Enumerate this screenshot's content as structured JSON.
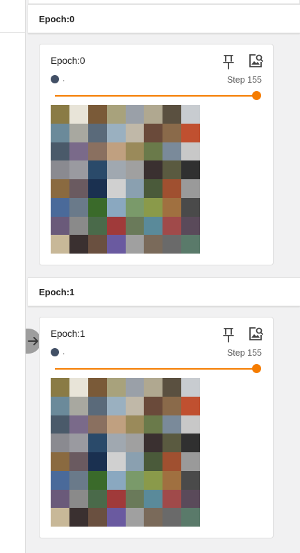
{
  "groups": [
    {
      "header_title": "Epoch:0",
      "card": {
        "title": "Epoch:0",
        "run_name": ".",
        "step_text": "Step 155",
        "slider_value_fraction": 1.0
      }
    },
    {
      "header_title": "Epoch:1",
      "card": {
        "title": "Epoch:1",
        "run_name": ".",
        "step_text": "Step 155",
        "slider_value_fraction": 1.0
      }
    }
  ],
  "icons": {
    "pin": "pin-icon",
    "image_settings": "image-search-icon",
    "expand": "arrow-right-icon"
  },
  "colors": {
    "accent": "#f57c00",
    "run_dot": "#425066"
  },
  "image_tiles": [
    "#8a7b45",
    "#e8e4d8",
    "#7a5a38",
    "#a8a27c",
    "#9aa0a8",
    "#b0a890",
    "#5a5040",
    "#c8ccd0",
    "#6b8a9a",
    "#a8a8a0",
    "#5a6a7a",
    "#9ab0c0",
    "#c0b8a8",
    "#6a4a3a",
    "#8a6a4a",
    "#c05030",
    "#4a5a6a",
    "#7a6a8a",
    "#8a7060",
    "#c0a080",
    "#9a8a5a",
    "#6a7a4a",
    "#7a8a9a",
    "#c8c8c8",
    "#8a8a90",
    "#9a9aa0",
    "#2a4a6a",
    "#a0a8b0",
    "#a0a0a0",
    "#3a3030",
    "#5a5a40",
    "#303030",
    "#8a6a40",
    "#6a5a60",
    "#1a3050",
    "#d0d0d0",
    "#8aa0b0",
    "#4a5a3a",
    "#a05030",
    "#9a9a9a",
    "#4a6a9a",
    "#6a7a8a",
    "#3a6a2a",
    "#8aa8c0",
    "#7a9a6a",
    "#8a9a4a",
    "#a07040",
    "#4a4a4a",
    "#6a5a7a",
    "#8a8a8a",
    "#4a6a4a",
    "#a03a3a",
    "#6a7a5a",
    "#5a8a9a",
    "#a04a4a",
    "#5a4a5a",
    "#c8b898",
    "#3a3030",
    "#6a5040",
    "#6a5aa0",
    "#a0a0a0",
    "#7a6a5a",
    "#6a6a6a",
    "#5a7a6a"
  ]
}
